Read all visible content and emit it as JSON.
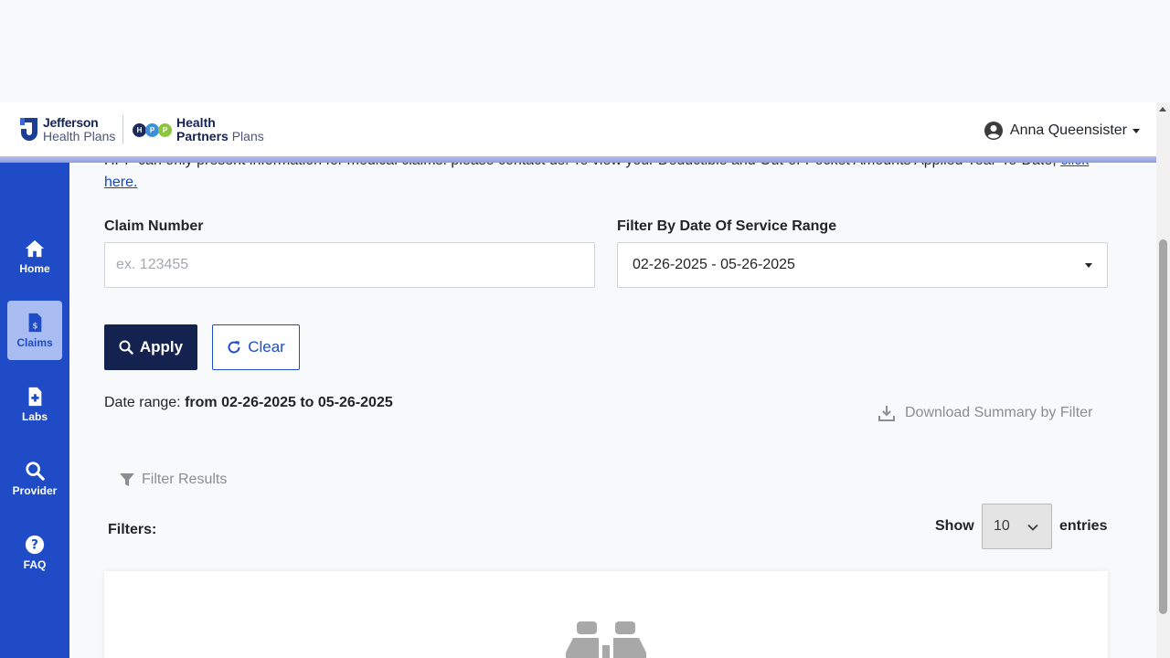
{
  "header": {
    "logo_jefferson_line1": "Jefferson",
    "logo_jefferson_line2": "Health Plans",
    "logo_hpp_line1": "Health",
    "logo_hpp_line2a": "Partners",
    "logo_hpp_line2b": "Plans",
    "hpp_letters": [
      "H",
      "P",
      "P"
    ],
    "user_name": "Anna Queensister"
  },
  "sidebar": {
    "items": [
      {
        "label": "Home",
        "icon": "home-icon"
      },
      {
        "label": "Claims",
        "icon": "claims-icon",
        "active": true
      },
      {
        "label": "Labs",
        "icon": "labs-icon"
      },
      {
        "label": "Provider",
        "icon": "search-icon"
      },
      {
        "label": "FAQ",
        "icon": "question-icon"
      }
    ]
  },
  "notice": {
    "text": "HPP can only present information for medical claims. please contact us. To view your Deductible and Out-of-Pocket Amounts Applied Year-To-Date,",
    "link": "click here."
  },
  "form": {
    "claim_label": "Claim Number",
    "claim_placeholder": "ex. 123455",
    "claim_value": "",
    "date_label": "Filter By Date Of Service Range",
    "date_value": "02-26-2025 - 05-26-2025",
    "apply_label": "Apply",
    "clear_label": "Clear"
  },
  "results": {
    "date_range_prefix": "Date range:",
    "date_range_value": "from 02-26-2025 to 05-26-2025",
    "download_label": "Download Summary by Filter",
    "filter_results_label": "Filter Results",
    "filters_label": "Filters:",
    "show_label": "Show",
    "entries_value": "10",
    "entries_label": "entries"
  },
  "colors": {
    "sidebar": "#1f4cc6",
    "sidebar_active": "#a9bdf3",
    "apply_button": "#14224f",
    "link": "#0d47c9"
  }
}
